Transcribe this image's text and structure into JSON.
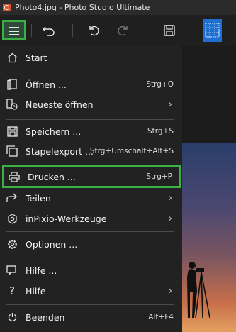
{
  "window": {
    "title": "Photo4.jpg - Photo Studio Ultimate"
  },
  "toolbar": {
    "menu_icon": "hamburger-icon",
    "undo_icon": "undo-icon",
    "redo_icon": "redo-icon",
    "save_icon": "save-icon"
  },
  "menu": {
    "start": "Start",
    "open": "Öffnen ...",
    "open_sc": "Strg+O",
    "recent": "Neueste öffnen",
    "save": "Speichern ...",
    "save_sc": "Strg+S",
    "batch": "Stapelexport ...",
    "batch_sc": "Strg+Umschalt+Alt+S",
    "print": "Drucken ...",
    "print_sc": "Strg+P",
    "share": "Teilen",
    "tools": "inPixio-Werkzeuge",
    "options": "Optionen ...",
    "help_dialog": "Hilfe ...",
    "help": "Hilfe",
    "quit": "Beenden",
    "quit_sc": "Alt+F4"
  },
  "colors": {
    "highlight": "#3cb043",
    "accent": "#1e6fd0"
  }
}
